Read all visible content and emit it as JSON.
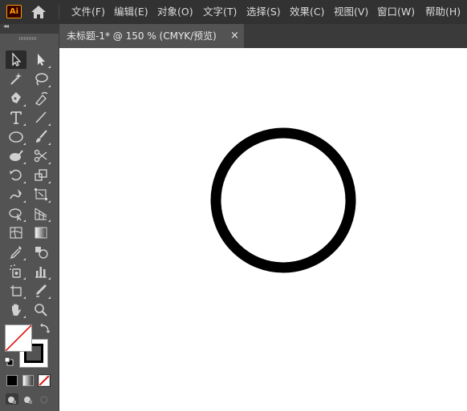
{
  "app": {
    "logo_text": "Ai",
    "home_icon": "home-icon"
  },
  "menu": {
    "items": [
      {
        "label": "文件(F)"
      },
      {
        "label": "编辑(E)"
      },
      {
        "label": "对象(O)"
      },
      {
        "label": "文字(T)"
      },
      {
        "label": "选择(S)"
      },
      {
        "label": "效果(C)"
      },
      {
        "label": "视图(V)"
      },
      {
        "label": "窗口(W)"
      },
      {
        "label": "帮助(H)"
      }
    ]
  },
  "document": {
    "tab_title": "未标题-1* @ 150 % (CMYK/预览)",
    "close_glyph": "×",
    "artboard_color": "#ffffff"
  },
  "artwork": {
    "shape": "circle",
    "fill": "none",
    "stroke_color": "#000000"
  },
  "tools": {
    "collapse_glyph": "◂◂",
    "items": [
      "selection-tool-icon",
      "direct-selection-tool-icon",
      "magic-wand-tool-icon",
      "lasso-tool-icon",
      "pen-tool-icon",
      "curvature-tool-icon",
      "type-tool-icon",
      "line-segment-tool-icon",
      "ellipse-tool-icon",
      "paintbrush-tool-icon",
      "shaper-tool-icon",
      "scissors-tool-icon",
      "rotate-tool-icon",
      "scale-tool-icon",
      "warp-tool-icon",
      "free-transform-tool-icon",
      "shape-builder-tool-icon",
      "perspective-grid-tool-icon",
      "mesh-tool-icon",
      "gradient-tool-icon",
      "eyedropper-tool-icon",
      "blend-tool-icon",
      "symbol-sprayer-tool-icon",
      "column-graph-tool-icon",
      "artboard-tool-icon",
      "slice-tool-icon",
      "hand-tool-icon",
      "zoom-tool-icon"
    ],
    "fill_color": "none",
    "stroke_color": "#000000"
  }
}
